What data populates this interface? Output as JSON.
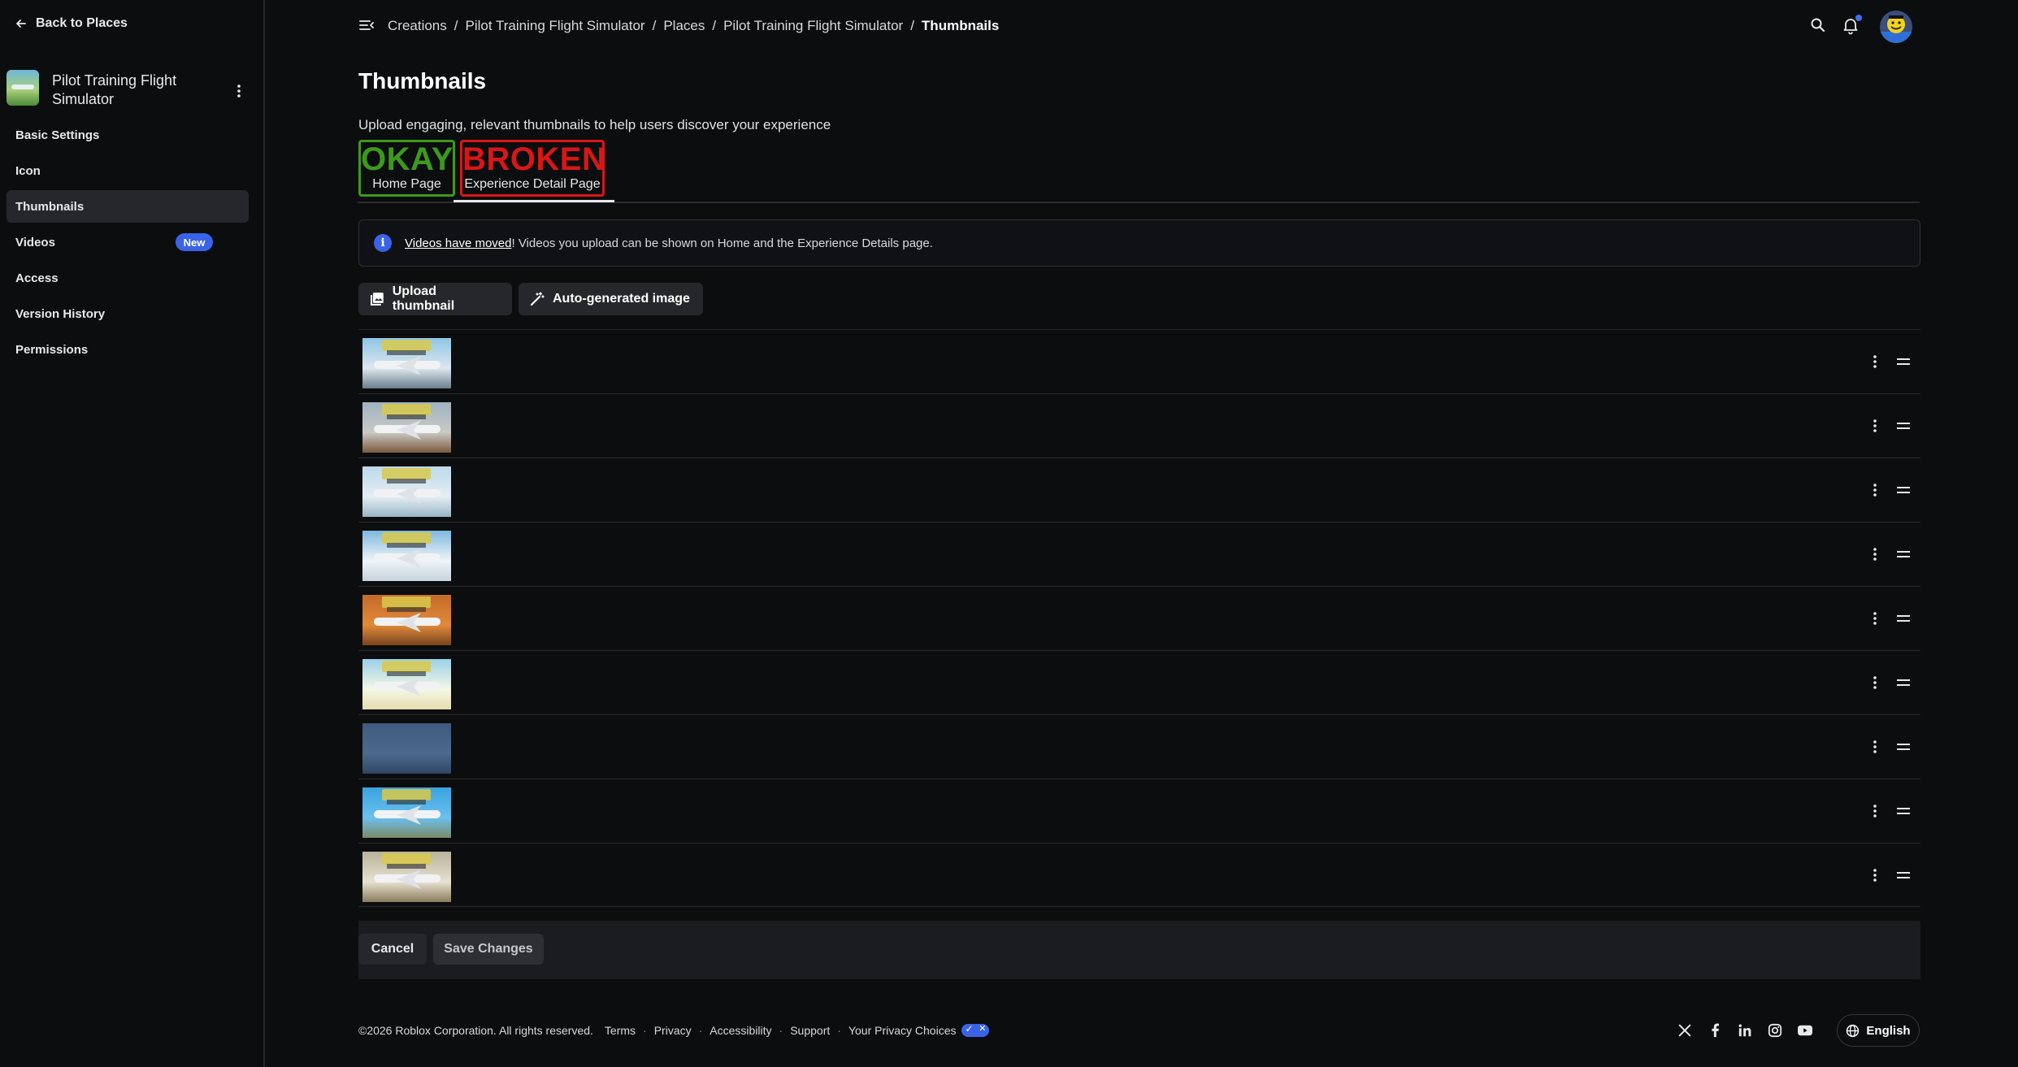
{
  "sidebar": {
    "back_label": "Back to Places",
    "experience_title": "Pilot Training Flight Simulator",
    "items": [
      {
        "label": "Basic Settings"
      },
      {
        "label": "Icon"
      },
      {
        "label": "Thumbnails"
      },
      {
        "label": "Videos",
        "badge": "New"
      },
      {
        "label": "Access"
      },
      {
        "label": "Version History"
      },
      {
        "label": "Permissions"
      }
    ],
    "active_item": "Thumbnails"
  },
  "header": {
    "breadcrumb": [
      "Creations",
      "Pilot Training Flight Simulator",
      "Places",
      "Pilot Training Flight Simulator",
      "Thumbnails"
    ],
    "separator": "/"
  },
  "main": {
    "title": "Thumbnails",
    "subtitle": "Upload engaging, relevant thumbnails to help users discover your experience",
    "tabs": [
      {
        "status": "OKAY",
        "label": "Home Page",
        "color": "#3c9a1a"
      },
      {
        "status": "BROKEN",
        "label": "Experience Detail Page",
        "color": "#d91616"
      }
    ],
    "info_banner": {
      "link_text": "Videos have moved",
      "rest_text": "! Videos you upload can be shown on Home and the Experience Details page."
    },
    "upload_label": "Upload thumbnail",
    "auto_label": "Auto-generated image",
    "thumbnails": [
      {
        "icon": "thumbnail-image"
      },
      {
        "icon": "thumbnail-image"
      },
      {
        "icon": "thumbnail-image"
      },
      {
        "icon": "thumbnail-image"
      },
      {
        "icon": "thumbnail-image"
      },
      {
        "icon": "thumbnail-image"
      },
      {
        "icon": "thumbnail-image"
      },
      {
        "icon": "thumbnail-image"
      },
      {
        "icon": "thumbnail-image"
      }
    ],
    "cancel_label": "Cancel",
    "save_label": "Save Changes"
  },
  "footer": {
    "copyright": "©2026 Roblox Corporation. All rights reserved.",
    "links": [
      "Terms",
      "Privacy",
      "Accessibility",
      "Support",
      "Your Privacy Choices"
    ],
    "socials": [
      "x-icon",
      "facebook-icon",
      "linkedin-icon",
      "instagram-icon",
      "youtube-icon"
    ],
    "language": "English"
  },
  "colors": {
    "background": "#0c0d0f",
    "accent": "#3a63e8",
    "okay": "#3c9a1a",
    "broken": "#d91616"
  }
}
